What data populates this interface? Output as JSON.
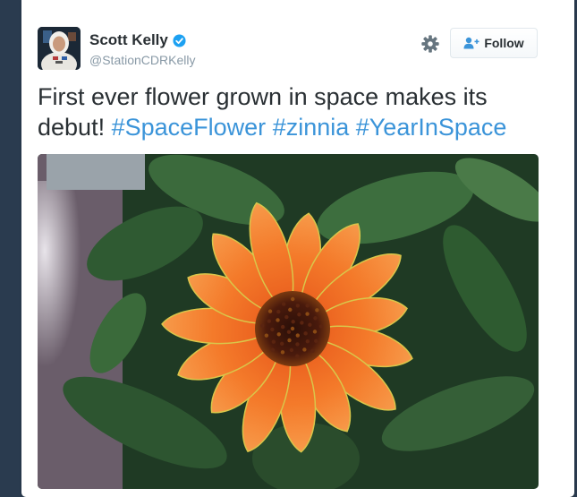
{
  "tweet": {
    "author_name": "Scott Kelly",
    "author_handle": "@StationCDRKelly",
    "follow_label": "Follow",
    "text_plain": "First ever flower grown in space makes its debut! ",
    "hashtags": [
      "#SpaceFlower",
      "#zinnia",
      "#YearInSpace"
    ]
  },
  "icons": {
    "verified": "verified-badge-icon",
    "settings": "gear-icon",
    "follow": "add-user-icon"
  },
  "colors": {
    "hashtag": "#3b94d9",
    "verified": "#1da1f2",
    "name": "#292f33",
    "handle": "#8899a6"
  }
}
